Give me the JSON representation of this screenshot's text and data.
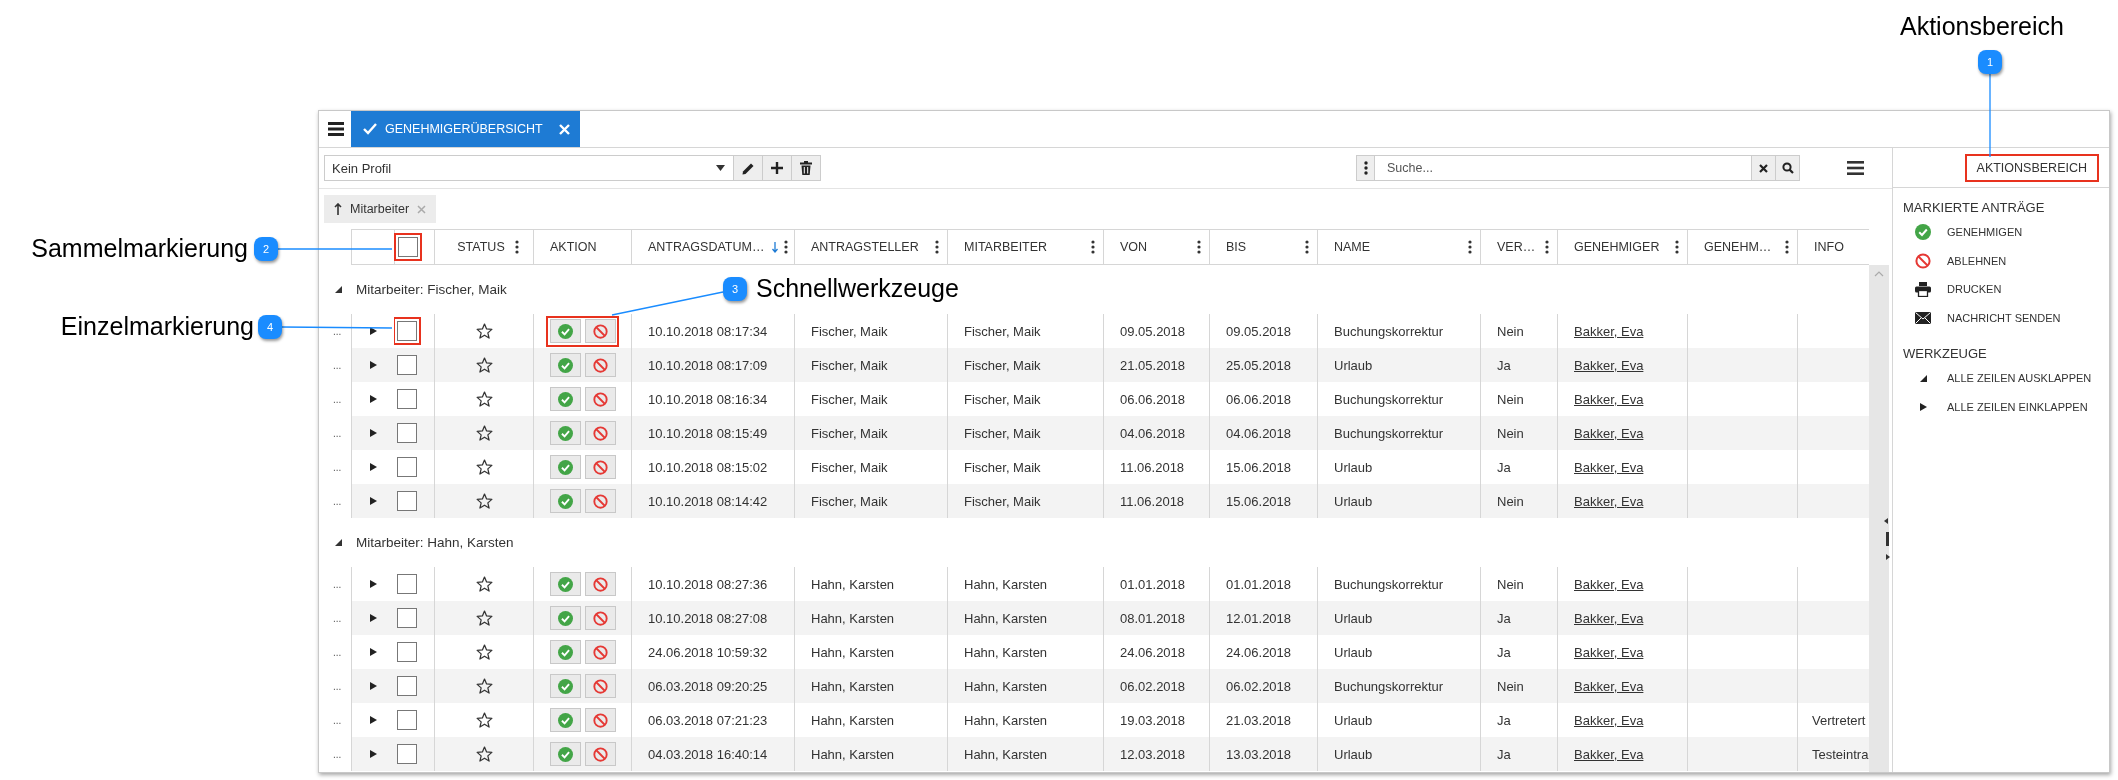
{
  "callouts": [
    {
      "number": "1",
      "label": "Aktionsbereich"
    },
    {
      "number": "2",
      "label": "Sammelmarkierung"
    },
    {
      "number": "3",
      "label": "Schnellwerkzeuge"
    },
    {
      "number": "4",
      "label": "Einzelmarkierung"
    }
  ],
  "tab": {
    "label": "GENEHMIGERÜBERSICHT",
    "selected": true
  },
  "profile": {
    "value": "Kein Profil"
  },
  "search": {
    "placeholder": "Suche..."
  },
  "filter_chip": {
    "label": "Mitarbeiter"
  },
  "table": {
    "select_all": {
      "checked": false,
      "highlighted": true
    },
    "columns": [
      {
        "label": "STATUS",
        "menu": true,
        "sorted": false
      },
      {
        "label": "AKTION",
        "menu": false,
        "sorted": false
      },
      {
        "label": "ANTRAGSDATUM…",
        "menu": true,
        "sorted": true
      },
      {
        "label": "ANTRAGSTELLER",
        "menu": true,
        "sorted": false
      },
      {
        "label": "MITARBEITER",
        "menu": true,
        "sorted": false
      },
      {
        "label": "VON",
        "menu": true,
        "sorted": false
      },
      {
        "label": "BIS",
        "menu": true,
        "sorted": false
      },
      {
        "label": "NAME",
        "menu": true,
        "sorted": false
      },
      {
        "label": "VER…",
        "menu": true,
        "sorted": false
      },
      {
        "label": "GENEHMIGER",
        "menu": true,
        "sorted": false
      },
      {
        "label": "GENEHM…",
        "menu": true,
        "sorted": false
      },
      {
        "label": "INFO",
        "menu": false,
        "sorted": false
      }
    ],
    "groups": [
      {
        "label": "Mitarbeiter: Fischer, Maik",
        "expanded": true,
        "rows": [
          {
            "handle": "...",
            "expanded": false,
            "checked": false,
            "highlighted": true,
            "date": "10.10.2018 08:17:34",
            "applicant": "Fischer, Maik",
            "employee": "Fischer, Maik",
            "from": "09.05.2018",
            "to": "09.05.2018",
            "name": "Buchungskorrektur",
            "substitute": "Nein",
            "approver": "Bakker, Eva"
          },
          {
            "handle": "...",
            "expanded": false,
            "checked": false,
            "highlighted": false,
            "date": "10.10.2018 08:17:09",
            "applicant": "Fischer, Maik",
            "employee": "Fischer, Maik",
            "from": "21.05.2018",
            "to": "25.05.2018",
            "name": "Urlaub",
            "substitute": "Ja",
            "approver": "Bakker, Eva"
          },
          {
            "handle": "...",
            "expanded": false,
            "checked": false,
            "highlighted": false,
            "date": "10.10.2018 08:16:34",
            "applicant": "Fischer, Maik",
            "employee": "Fischer, Maik",
            "from": "06.06.2018",
            "to": "06.06.2018",
            "name": "Buchungskorrektur",
            "substitute": "Nein",
            "approver": "Bakker, Eva"
          },
          {
            "handle": "...",
            "expanded": false,
            "checked": false,
            "highlighted": false,
            "date": "10.10.2018 08:15:49",
            "applicant": "Fischer, Maik",
            "employee": "Fischer, Maik",
            "from": "04.06.2018",
            "to": "04.06.2018",
            "name": "Buchungskorrektur",
            "substitute": "Nein",
            "approver": "Bakker, Eva"
          },
          {
            "handle": "...",
            "expanded": false,
            "checked": false,
            "highlighted": false,
            "date": "10.10.2018 08:15:02",
            "applicant": "Fischer, Maik",
            "employee": "Fischer, Maik",
            "from": "11.06.2018",
            "to": "15.06.2018",
            "name": "Urlaub",
            "substitute": "Ja",
            "approver": "Bakker, Eva"
          },
          {
            "handle": "...",
            "expanded": false,
            "checked": false,
            "highlighted": false,
            "date": "10.10.2018 08:14:42",
            "applicant": "Fischer, Maik",
            "employee": "Fischer, Maik",
            "from": "11.06.2018",
            "to": "15.06.2018",
            "name": "Urlaub",
            "substitute": "Nein",
            "approver": "Bakker, Eva"
          }
        ]
      },
      {
        "label": "Mitarbeiter: Hahn, Karsten",
        "expanded": true,
        "rows": [
          {
            "handle": "...",
            "expanded": false,
            "checked": false,
            "highlighted": false,
            "date": "10.10.2018 08:27:36",
            "applicant": "Hahn, Karsten",
            "employee": "Hahn, Karsten",
            "from": "01.01.2018",
            "to": "01.01.2018",
            "name": "Buchungskorrektur",
            "substitute": "Nein",
            "approver": "Bakker, Eva"
          },
          {
            "handle": "...",
            "expanded": false,
            "checked": false,
            "highlighted": false,
            "date": "10.10.2018 08:27:08",
            "applicant": "Hahn, Karsten",
            "employee": "Hahn, Karsten",
            "from": "08.01.2018",
            "to": "12.01.2018",
            "name": "Urlaub",
            "substitute": "Ja",
            "approver": "Bakker, Eva"
          },
          {
            "handle": "...",
            "expanded": false,
            "checked": false,
            "highlighted": false,
            "date": "24.06.2018 10:59:32",
            "applicant": "Hahn, Karsten",
            "employee": "Hahn, Karsten",
            "from": "24.06.2018",
            "to": "24.06.2018",
            "name": "Urlaub",
            "substitute": "Ja",
            "approver": "Bakker, Eva"
          },
          {
            "handle": "...",
            "expanded": false,
            "checked": false,
            "highlighted": false,
            "date": "06.03.2018 09:20:25",
            "applicant": "Hahn, Karsten",
            "employee": "Hahn, Karsten",
            "from": "06.02.2018",
            "to": "06.02.2018",
            "name": "Buchungskorrektur",
            "substitute": "Nein",
            "approver": "Bakker, Eva"
          },
          {
            "handle": "...",
            "expanded": false,
            "checked": false,
            "highlighted": false,
            "date": "06.03.2018 07:21:23",
            "applicant": "Hahn, Karsten",
            "employee": "Hahn, Karsten",
            "from": "19.03.2018",
            "to": "21.03.2018",
            "name": "Urlaub",
            "substitute": "Ja",
            "approver": "Bakker, Eva",
            "info": "Vertretert"
          },
          {
            "handle": "...",
            "expanded": false,
            "checked": false,
            "highlighted": false,
            "date": "04.03.2018 16:40:14",
            "applicant": "Hahn, Karsten",
            "employee": "Hahn, Karsten",
            "from": "12.03.2018",
            "to": "13.03.2018",
            "name": "Urlaub",
            "substitute": "Ja",
            "approver": "Bakker, Eva",
            "info": "Testeintra"
          }
        ]
      }
    ]
  },
  "panel": {
    "button": {
      "label": "AKTIONSBEREICH",
      "highlighted": true
    },
    "sections": [
      {
        "title": "MARKIERTE ANTRÄGE",
        "items": [
          {
            "kind": "approve",
            "label": "GENEHMIGEN"
          },
          {
            "kind": "reject",
            "label": "ABLEHNEN"
          },
          {
            "kind": "print",
            "label": "DRUCKEN"
          },
          {
            "kind": "message",
            "label": "NACHRICHT SENDEN"
          }
        ]
      },
      {
        "title": "WERKZEUGE",
        "items": [
          {
            "kind": "expand",
            "label": "ALLE ZEILEN AUSKLAPPEN"
          },
          {
            "kind": "collapse",
            "label": "ALLE ZEILEN EINKLAPPEN"
          }
        ]
      }
    ]
  }
}
